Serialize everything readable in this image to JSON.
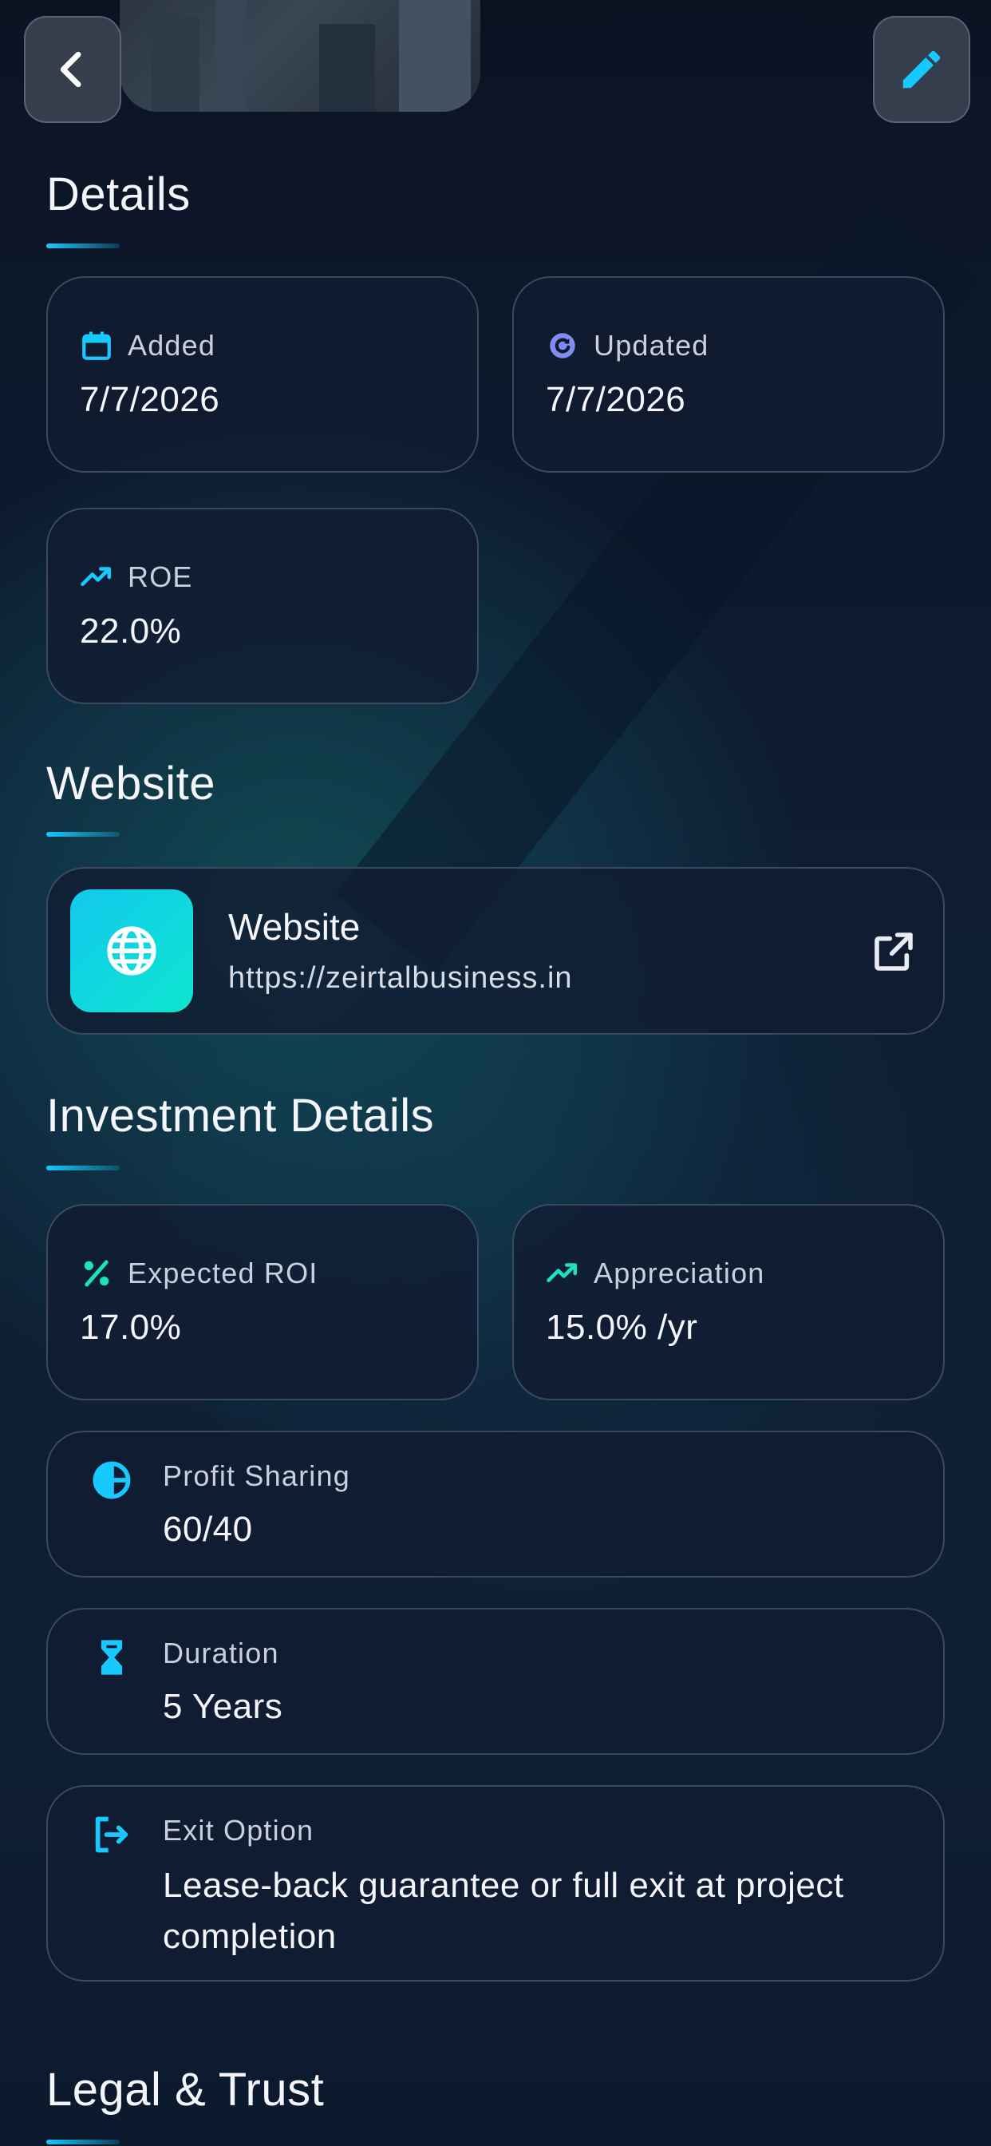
{
  "header": {
    "back_icon": "chevron-left-icon",
    "edit_icon": "pencil-icon",
    "accent_color": "#17c9ff"
  },
  "details": {
    "title": "Details",
    "added": {
      "label": "Added",
      "value": "7/7/2026",
      "icon": "calendar-icon"
    },
    "updated": {
      "label": "Updated",
      "value": "7/7/2026",
      "icon": "refresh-icon"
    },
    "roe": {
      "label": "ROE",
      "value": "22.0%",
      "icon": "trending-up-icon"
    }
  },
  "website": {
    "title": "Website",
    "card_title": "Website",
    "url": "https://zeirtalbusiness.in",
    "icon": "globe-icon",
    "open_icon": "external-link-icon"
  },
  "investment": {
    "title": "Investment Details",
    "expected_roi": {
      "label": "Expected ROI",
      "value": "17.0%",
      "icon": "percent-icon"
    },
    "appreciation": {
      "label": "Appreciation",
      "value": "15.0% /yr",
      "icon": "trending-up-icon"
    },
    "profit_sharing": {
      "label": "Profit Sharing",
      "value": "60/40",
      "icon": "pie-chart-icon"
    },
    "duration": {
      "label": "Duration",
      "value": "5 Years",
      "icon": "hourglass-icon"
    },
    "exit_option": {
      "label": "Exit Option",
      "value": "Lease-back guarantee or full exit at project completion",
      "icon": "exit-icon"
    }
  },
  "legal": {
    "title": "Legal & Trust"
  }
}
